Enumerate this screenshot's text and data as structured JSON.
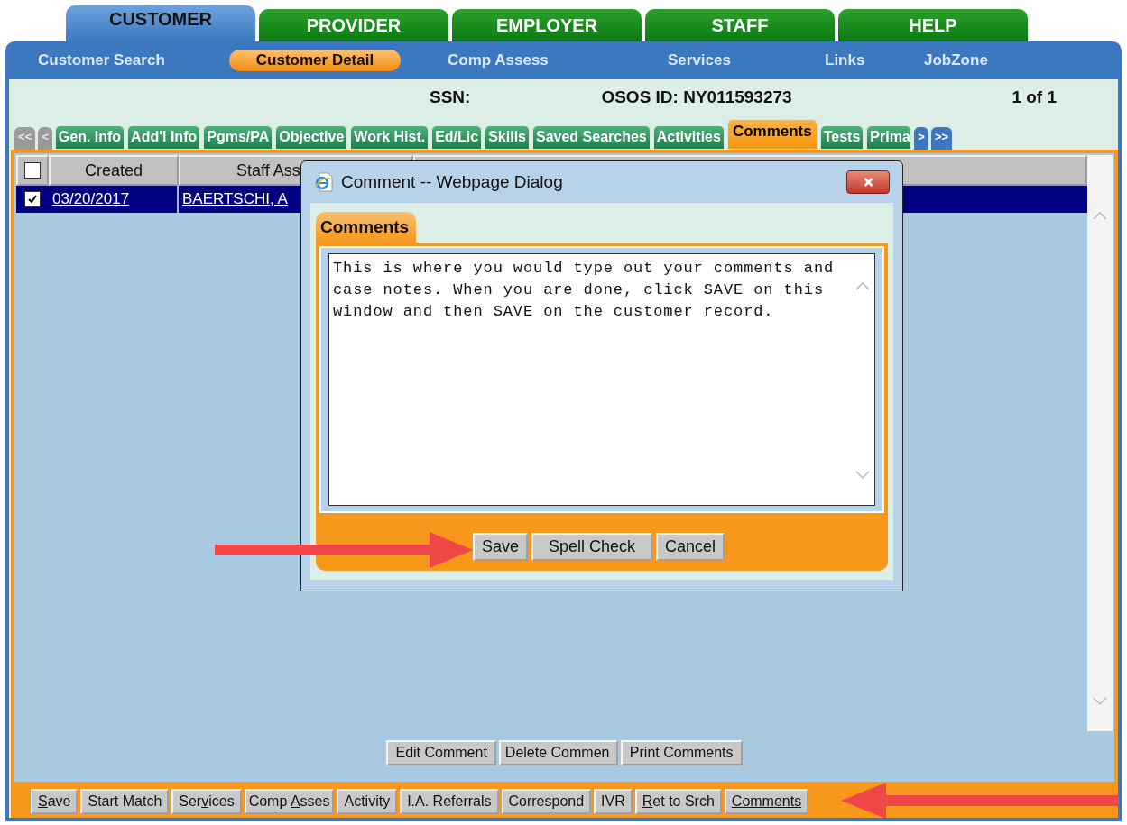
{
  "main_tabs": [
    {
      "label": "CUSTOMER",
      "selected": true
    },
    {
      "label": "PROVIDER",
      "selected": false
    },
    {
      "label": "EMPLOYER",
      "selected": false
    },
    {
      "label": "STAFF",
      "selected": false
    },
    {
      "label": "HELP",
      "selected": false
    }
  ],
  "nav": [
    {
      "label": "Customer Search",
      "selected": false
    },
    {
      "label": "Customer Detail",
      "selected": true
    },
    {
      "label": "Comp Assess",
      "selected": false
    },
    {
      "label": "Services",
      "selected": false
    },
    {
      "label": "Links",
      "selected": false
    },
    {
      "label": "JobZone",
      "selected": false
    }
  ],
  "info": {
    "ssn_label": "SSN:",
    "osos_id": "OSOS ID: NY011593273",
    "record_count": "1 of 1"
  },
  "sub_tabs": [
    {
      "label": "<<",
      "kind": "nav",
      "disabled": true
    },
    {
      "label": "<",
      "kind": "nav",
      "disabled": true
    },
    {
      "label": "Gen. Info",
      "kind": "tab",
      "selected": false
    },
    {
      "label": "Add'l Info",
      "kind": "tab",
      "selected": false
    },
    {
      "label": "Pgms/PA",
      "kind": "tab",
      "selected": false
    },
    {
      "label": "Objective",
      "kind": "tab",
      "selected": false
    },
    {
      "label": "Work Hist.",
      "kind": "tab",
      "selected": false
    },
    {
      "label": "Ed/Lic",
      "kind": "tab",
      "selected": false
    },
    {
      "label": "Skills",
      "kind": "tab",
      "selected": false
    },
    {
      "label": "Saved Searches",
      "kind": "tab",
      "selected": false
    },
    {
      "label": "Activities",
      "kind": "tab",
      "selected": false
    },
    {
      "label": "Comments",
      "kind": "tab",
      "selected": true
    },
    {
      "label": "Tests",
      "kind": "tab",
      "selected": false
    },
    {
      "label": "Prima",
      "kind": "tab",
      "selected": false
    },
    {
      "label": ">",
      "kind": "nav",
      "disabled": false
    },
    {
      "label": ">>",
      "kind": "nav",
      "disabled": false
    }
  ],
  "table": {
    "select_all_checked": false,
    "columns": [
      "Created",
      "Staff Ass"
    ],
    "rows": [
      {
        "checked": true,
        "selected": true,
        "cells": [
          "03/20/2017",
          "BAERTSCHI, A"
        ]
      }
    ]
  },
  "comment_buttons": [
    "Edit Comment",
    "Delete Commen",
    "Print Comments"
  ],
  "bottom_buttons": [
    {
      "key": "S",
      "post": "ave"
    },
    {
      "pre": "Start Match"
    },
    {
      "pre": "Ser",
      "key": "v",
      "post": "ices"
    },
    {
      "pre": "Comp ",
      "key": "A",
      "post": "sses"
    },
    {
      "pre": "Activity"
    },
    {
      "pre": "I.A. Referrals"
    },
    {
      "pre": "Correspond"
    },
    {
      "pre": "IVR"
    },
    {
      "key": "R",
      "post": "et to Srch"
    },
    {
      "key": "Comments"
    }
  ],
  "dialog": {
    "title": "Comment -- Webpage Dialog",
    "tab": "Comments",
    "text": "This is where you would type out your comments and case notes. When you are done, click SAVE on this window and then SAVE on the customer record.",
    "buttons": [
      "Save",
      "Spell Check",
      "Cancel"
    ]
  }
}
